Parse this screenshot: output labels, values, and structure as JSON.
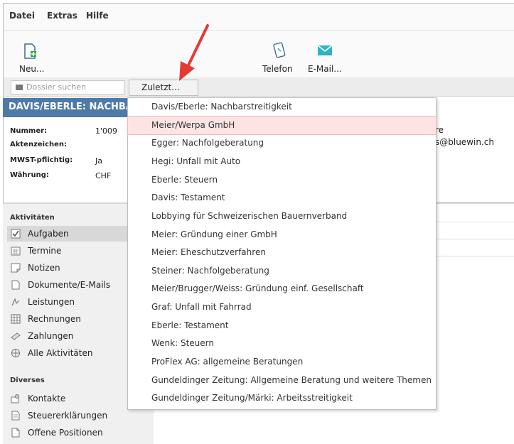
{
  "menu": [
    "Datei",
    "Extras",
    "Hilfe"
  ],
  "toolbar": {
    "new_label": "Neu...",
    "phone_label": "Telefon",
    "email_label": "E-Mail..."
  },
  "search": {
    "placeholder": "Dossier suchen",
    "recent_button": "Zuletzt..."
  },
  "dossier": {
    "title": "DAVIS/EBERLE: NACHBA",
    "fields": [
      {
        "label": "Nummer:",
        "value": "1'009"
      },
      {
        "label": "Aktenzeichen:",
        "value": ""
      },
      {
        "label": "MWST-pflichtig:",
        "value": "Ja"
      },
      {
        "label": "Währung:",
        "value": "CHF"
      }
    ],
    "right_fragments": [
      "re",
      "s@bluewin.ch"
    ]
  },
  "sidebar": {
    "activities_header": "Aktivitäten",
    "activities": [
      {
        "label": "Aufgaben",
        "icon": "checklist-icon",
        "selected": true
      },
      {
        "label": "Termine",
        "icon": "calendar-icon"
      },
      {
        "label": "Notizen",
        "icon": "note-icon"
      },
      {
        "label": "Dokumente/E-Mails",
        "icon": "document-icon"
      },
      {
        "label": "Leistungen",
        "icon": "services-icon"
      },
      {
        "label": "Rechnungen",
        "icon": "invoice-icon"
      },
      {
        "label": "Zahlungen",
        "icon": "payment-icon"
      },
      {
        "label": "Alle Aktivitäten",
        "icon": "all-activities-icon"
      }
    ],
    "misc_header": "Diverses",
    "misc": [
      {
        "label": "Kontakte",
        "icon": "contacts-icon"
      },
      {
        "label": "Steuererklärungen",
        "icon": "tax-return-icon"
      },
      {
        "label": "Offene Positionen",
        "icon": "open-items-icon"
      }
    ]
  },
  "recent_dossiers": [
    "Davis/Eberle: Nachbarstreitigkeit",
    "Meier/Werpa GmbH",
    "Egger: Nachfolgeberatung",
    "Hegi: Unfall mit Auto",
    "Eberle: Steuern",
    "Davis: Testament",
    "Lobbying für Schweizerischen Bauernverband",
    "Meier: Gründung einer GmbH",
    "Meier: Eheschutzverfahren",
    "Steiner: Nachfolgeberatung",
    "Meier/Brugger/Weiss: Gründung einf. Gesellschaft",
    "Graf: Unfall mit Fahrrad",
    "Eberle: Testament",
    "Wenk: Steuern",
    "ProFlex AG: allgemeine Beratungen",
    "Gundeldinger Zeitung: Allgemeine Beratung und weitere Themen",
    "Gundeldinger Zeitung/Märki: Arbeitsstreitigkeit"
  ],
  "highlighted_index": 1,
  "colors": {
    "title_bar": "#4d7aa8",
    "highlight": "#fce4e4",
    "arrow": "#e53935"
  }
}
